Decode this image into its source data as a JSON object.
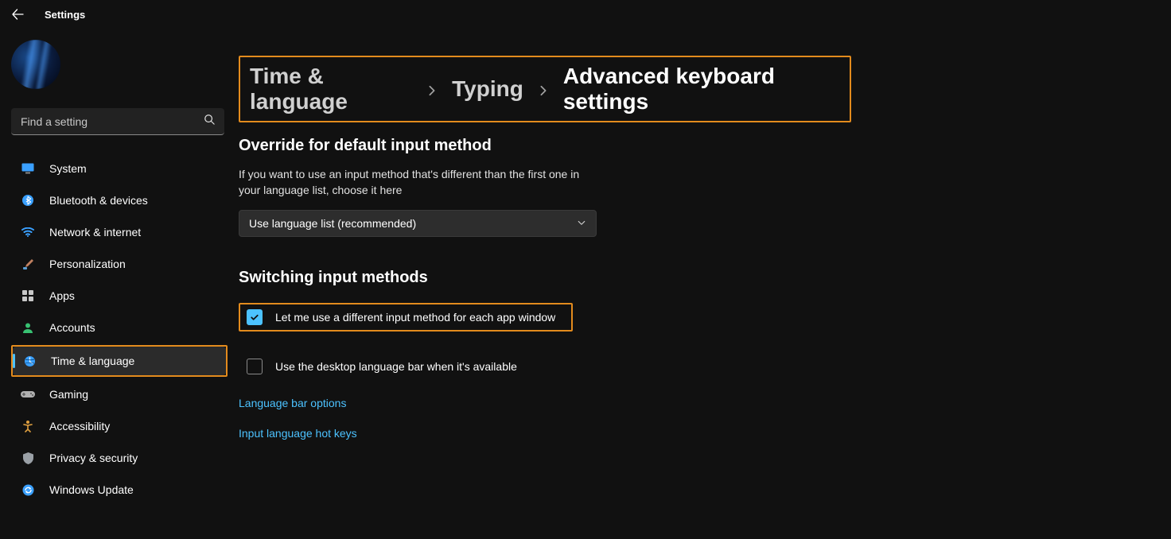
{
  "app": {
    "title": "Settings"
  },
  "search": {
    "placeholder": "Find a setting"
  },
  "sidebar": {
    "items": [
      {
        "label": "System",
        "icon": "monitor-icon",
        "color": "#3aa0ff"
      },
      {
        "label": "Bluetooth & devices",
        "icon": "bluetooth-icon",
        "color": "#3aa0ff"
      },
      {
        "label": "Network & internet",
        "icon": "wifi-icon",
        "color": "#3aa0ff"
      },
      {
        "label": "Personalization",
        "icon": "brush-icon",
        "color": "#c08060"
      },
      {
        "label": "Apps",
        "icon": "apps-icon",
        "color": "#c8c8c8"
      },
      {
        "label": "Accounts",
        "icon": "person-icon",
        "color": "#38c172"
      },
      {
        "label": "Time & language",
        "icon": "clock-globe-icon",
        "color": "#3aa0ff",
        "selected": true,
        "highlighted": true
      },
      {
        "label": "Gaming",
        "icon": "gamepad-icon",
        "color": "#b0b0b0"
      },
      {
        "label": "Accessibility",
        "icon": "accessibility-icon",
        "color": "#e0a040"
      },
      {
        "label": "Privacy & security",
        "icon": "shield-icon",
        "color": "#9aa0a6"
      },
      {
        "label": "Windows Update",
        "icon": "update-icon",
        "color": "#3aa0ff"
      }
    ]
  },
  "breadcrumb": {
    "parts": [
      "Time & language",
      "Typing",
      "Advanced keyboard settings"
    ],
    "highlighted": true
  },
  "sections": {
    "override": {
      "title": "Override for default input method",
      "desc": "If you want to use an input method that's different than the first one in your language list, choose it here",
      "dropdown_value": "Use language list (recommended)"
    },
    "switching": {
      "title": "Switching input methods",
      "cb1_label": "Let me use a different input method for each app window",
      "cb1_checked": true,
      "cb1_highlighted": true,
      "cb2_label": "Use the desktop language bar when it's available",
      "cb2_checked": false,
      "link1": "Language bar options",
      "link2": "Input language hot keys"
    }
  },
  "highlight_color": "#e38b1d"
}
